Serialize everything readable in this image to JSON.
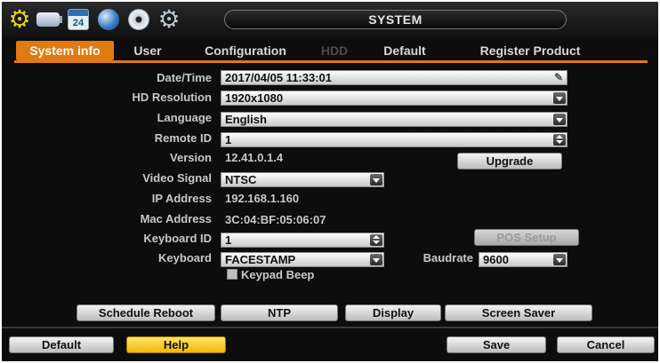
{
  "header": {
    "title": "SYSTEM",
    "calendar_day": "24",
    "icons": [
      "settings-gear-icon",
      "battery-icon",
      "calendar-icon",
      "globe-icon",
      "disc-icon",
      "settings-cog-icon"
    ]
  },
  "tabs": [
    {
      "label": "System info",
      "state": "active"
    },
    {
      "label": "User",
      "state": "normal"
    },
    {
      "label": "Configuration",
      "state": "normal"
    },
    {
      "label": "HDD",
      "state": "disabled"
    },
    {
      "label": "Default",
      "state": "normal"
    },
    {
      "label": "Register Product",
      "state": "normal"
    }
  ],
  "form": {
    "date_time": {
      "label": "Date/Time",
      "value": "2017/04/05 11:33:01"
    },
    "hd_resolution": {
      "label": "HD Resolution",
      "value": "1920x1080"
    },
    "language": {
      "label": "Language",
      "value": "English"
    },
    "remote_id": {
      "label": "Remote ID",
      "value": "1"
    },
    "version": {
      "label": "Version",
      "value": "12.41.0.1.4"
    },
    "upgrade_button": "Upgrade",
    "video_signal": {
      "label": "Video Signal",
      "value": "NTSC"
    },
    "ip_address": {
      "label": "IP Address",
      "value": "192.168.1.160"
    },
    "mac_address": {
      "label": "Mac Address",
      "value": "3C:04:BF:05:06:07"
    },
    "keyboard_id": {
      "label": "Keyboard ID",
      "value": "1"
    },
    "pos_setup_button": "POS Setup",
    "keyboard": {
      "label": "Keyboard",
      "value": "FACESTAMP"
    },
    "baudrate": {
      "label": "Baudrate",
      "value": "9600"
    },
    "keypad_beep": {
      "label": "Keypad Beep",
      "checked": false
    }
  },
  "actions": {
    "schedule_reboot": "Schedule Reboot",
    "ntp": "NTP",
    "display": "Display",
    "screen_saver": "Screen Saver"
  },
  "footer": {
    "default": "Default",
    "help": "Help",
    "save": "Save",
    "cancel": "Cancel"
  },
  "colors": {
    "accent": "#e07a12",
    "help": "#f1b800",
    "background": "#0d0d0d"
  }
}
